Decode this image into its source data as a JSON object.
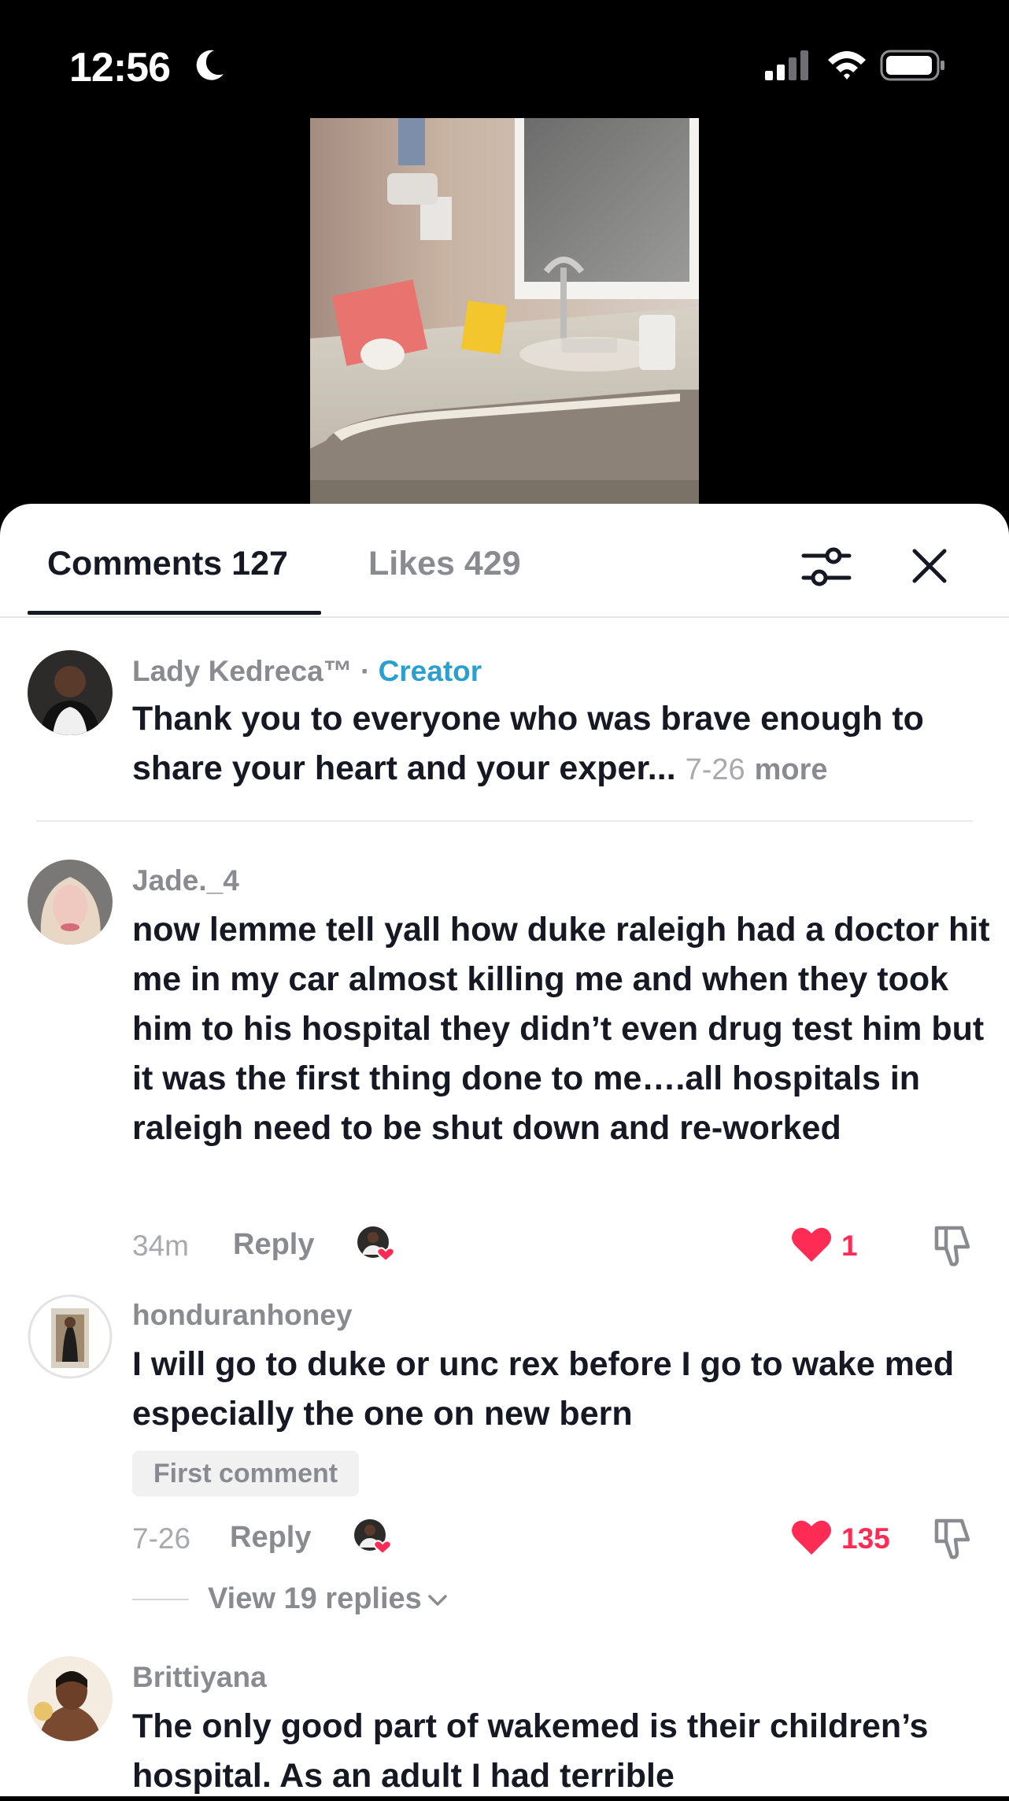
{
  "status_bar": {
    "time": "12:56",
    "icons": [
      "moon-icon",
      "cellular-signal-icon",
      "wifi-icon",
      "battery-icon"
    ]
  },
  "video": {
    "description_icon": "video-preview"
  },
  "sheet": {
    "tabs": [
      {
        "label": "Comments 127",
        "active": true
      },
      {
        "label": "Likes 429",
        "active": false
      }
    ],
    "icons": {
      "filter": "sliders-filter-icon",
      "close": "close-icon"
    }
  },
  "comments": [
    {
      "username": "Lady Kedreca™",
      "separator": " · ",
      "creator_label": "Creator",
      "text": "Thank you to everyone who was brave enough to share your heart and your exper...",
      "date": "7-26",
      "more_label": "more"
    },
    {
      "username": "Jade._4",
      "text": "now lemme tell yall how duke raleigh had a doctor hit me in my car almost killing me and when they took him to his hospital they didn’t even drug test him but it was the first thing done to me….all hospitals in raleigh need to be shut down and re-worked",
      "time": "34m",
      "reply_label": "Reply",
      "likes": "1"
    },
    {
      "username": "honduranhoney",
      "text": "I will go to duke or unc rex before I go to wake med especially the one on new bern",
      "badge": "First comment",
      "time": "7-26",
      "reply_label": "Reply",
      "likes": "135",
      "view_replies": "View 19 replies"
    },
    {
      "username": "Brittiyana",
      "text": "The only good part of wakemed is their children’s hospital. As an adult I had terrible"
    }
  ],
  "colors": {
    "accent_like": "#fe2c55",
    "creator": "#2a9fd0",
    "muted_text": "#8a8b91",
    "primary_text": "#161823"
  }
}
